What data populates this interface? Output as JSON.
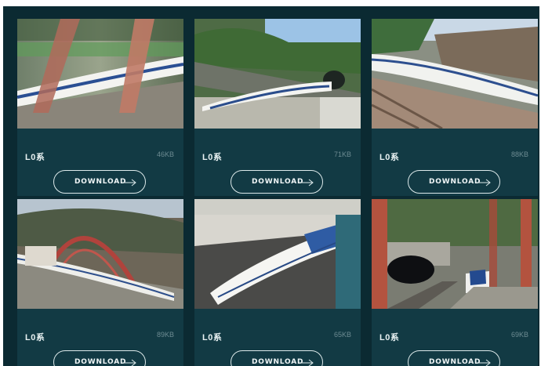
{
  "cards": [
    {
      "title": "L0系",
      "size": "46KB",
      "download_label": "DOWNLOAD"
    },
    {
      "title": "L0系",
      "size": "71KB",
      "download_label": "DOWNLOAD"
    },
    {
      "title": "L0系",
      "size": "88KB",
      "download_label": "DOWNLOAD"
    },
    {
      "title": "L0系",
      "size": "89KB",
      "download_label": "DOWNLOAD"
    },
    {
      "title": "L0系",
      "size": "65KB",
      "download_label": "DOWNLOAD"
    },
    {
      "title": "L0系",
      "size": "69KB",
      "download_label": "DOWNLOAD"
    }
  ],
  "icons": {
    "download_arrow": "arrow-right-icon"
  },
  "colors": {
    "panel_bg": "#0b2a32",
    "card_bg": "#123a44",
    "button_border": "#dce9ea",
    "size_text": "#6d8b92"
  }
}
